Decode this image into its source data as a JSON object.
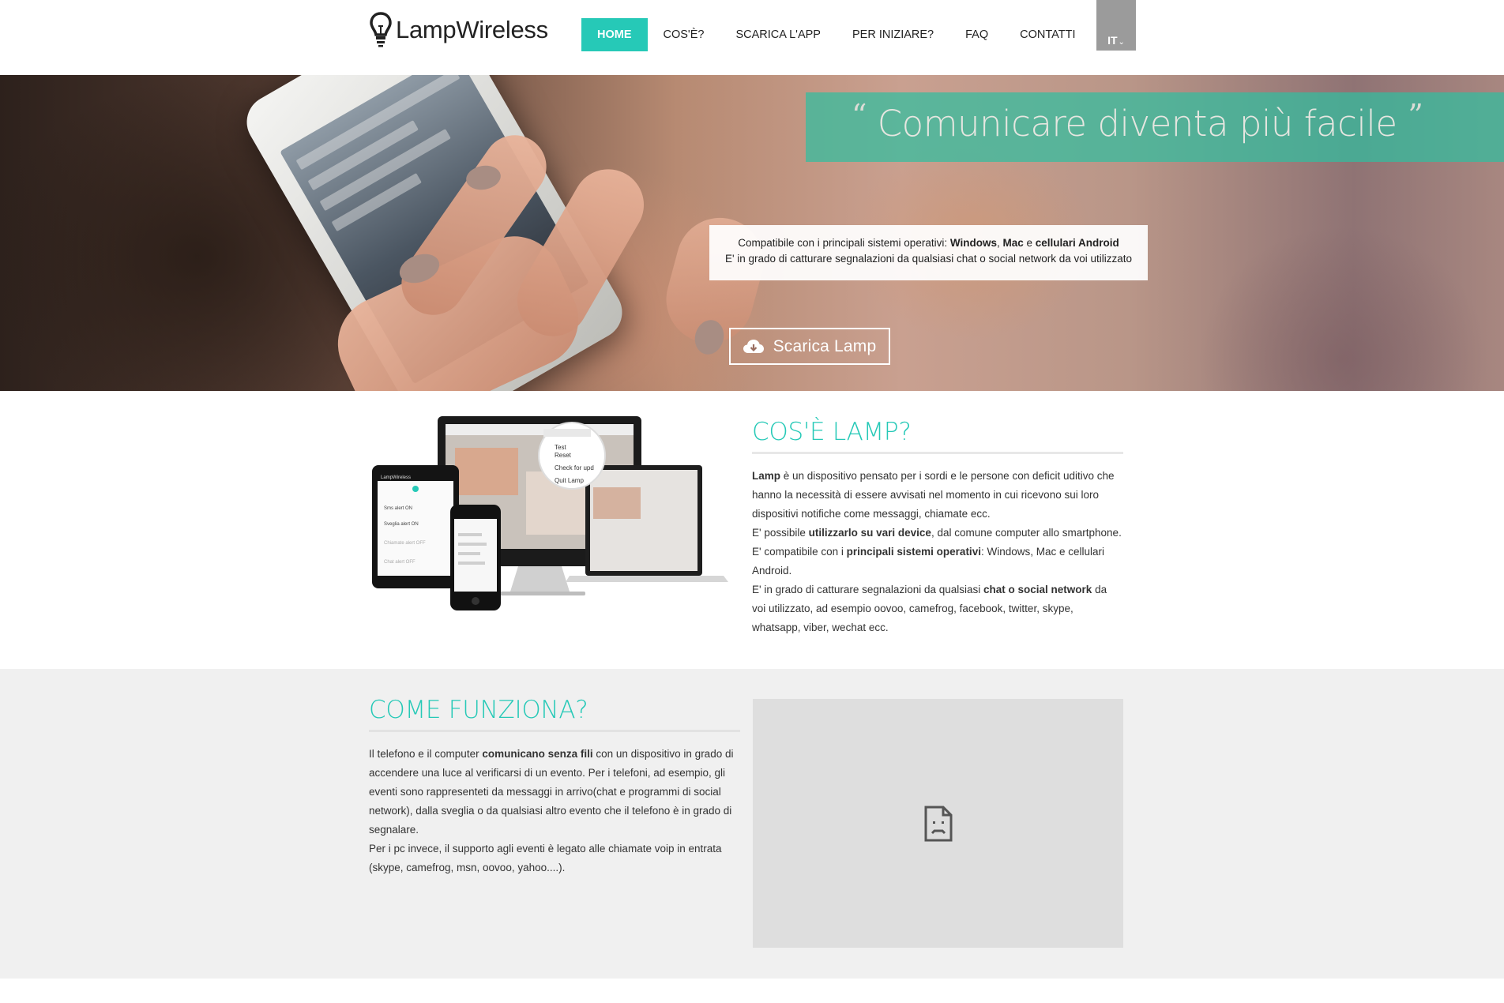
{
  "header": {
    "logo_text": "LampWireless",
    "nav": [
      {
        "label": "HOME",
        "active": true
      },
      {
        "label": "COS'È?"
      },
      {
        "label": "SCARICA L'APP"
      },
      {
        "label": "PER INIZIARE?"
      },
      {
        "label": "FAQ"
      },
      {
        "label": "CONTATTI"
      }
    ],
    "language": "IT"
  },
  "hero": {
    "quote_open": "“",
    "quote": "Comunicare diventa più facile",
    "quote_close": "”",
    "info_line1_pre": "Compatibile con i principali sistemi operativi: ",
    "info_line1_b1": "Windows",
    "info_line1_mid1": ", ",
    "info_line1_b2": "Mac",
    "info_line1_mid2": " e ",
    "info_line1_b3": "cellulari Android",
    "info_line2": "E' in grado di catturare segnalazioni da qualsiasi chat o social network da voi utilizzato",
    "cta_label": "Scarica Lamp",
    "cta_icon": "cloud-download-icon"
  },
  "what_is": {
    "title": "COS'È LAMP?",
    "p1_b": "Lamp",
    "p1": " è un dispositivo pensato per i sordi e le persone con deficit uditivo che hanno la necessità di essere avvisati nel momento in cui ricevono sui loro dispositivi notifiche come messaggi, chiamate ecc.",
    "p2_pre": "E' possibile ",
    "p2_b": "utilizzarlo su vari device",
    "p2_post": ", dal comune computer allo smartphone.",
    "p3_pre": "E' compatibile con i ",
    "p3_b": "principali sistemi operativi",
    "p3_post": ": Windows, Mac e cellulari Android.",
    "p4_pre": "E' in grado di catturare segnalazioni da qualsiasi ",
    "p4_b": "chat o social network",
    "p4_post": " da voi utilizzato, ad esempio oovoo, camefrog, facebook, twitter, skype, whatsapp, viber, wechat ecc.",
    "devices_image": {
      "tablet_header": "LampWireless",
      "tablet_rows": [
        "Sms alert ON",
        "Sveglia alert ON",
        "Chiamate alert OFF",
        "Chat alert OFF"
      ],
      "menu_items": [
        "Test",
        "Reset",
        "Check for upd",
        "Quit Lamp"
      ]
    }
  },
  "how_it_works": {
    "title": "COME FUNZIONA?",
    "p1_pre": "Il telefono e il computer ",
    "p1_b": "comunicano senza fili",
    "p1_post": " con un dispositivo in grado di accendere una luce al verificarsi di un evento. Per i telefoni, ad esempio, gli eventi sono rappresenteti da messaggi in arrivo(chat e programmi di social network), dalla sveglia o da qualsiasi altro evento che il telefono è in grado di segnalare.",
    "p2": "Per i pc invece, il supporto agli eventi è legato alle chiamate voip in entrata (skype, camefrog, msn, oovoo, yahoo....).",
    "video_icon": "broken-document-icon"
  },
  "colors": {
    "accent": "#26c9b7",
    "lang_bg": "#9b9b9b",
    "section_bg": "#f0f0f0"
  }
}
